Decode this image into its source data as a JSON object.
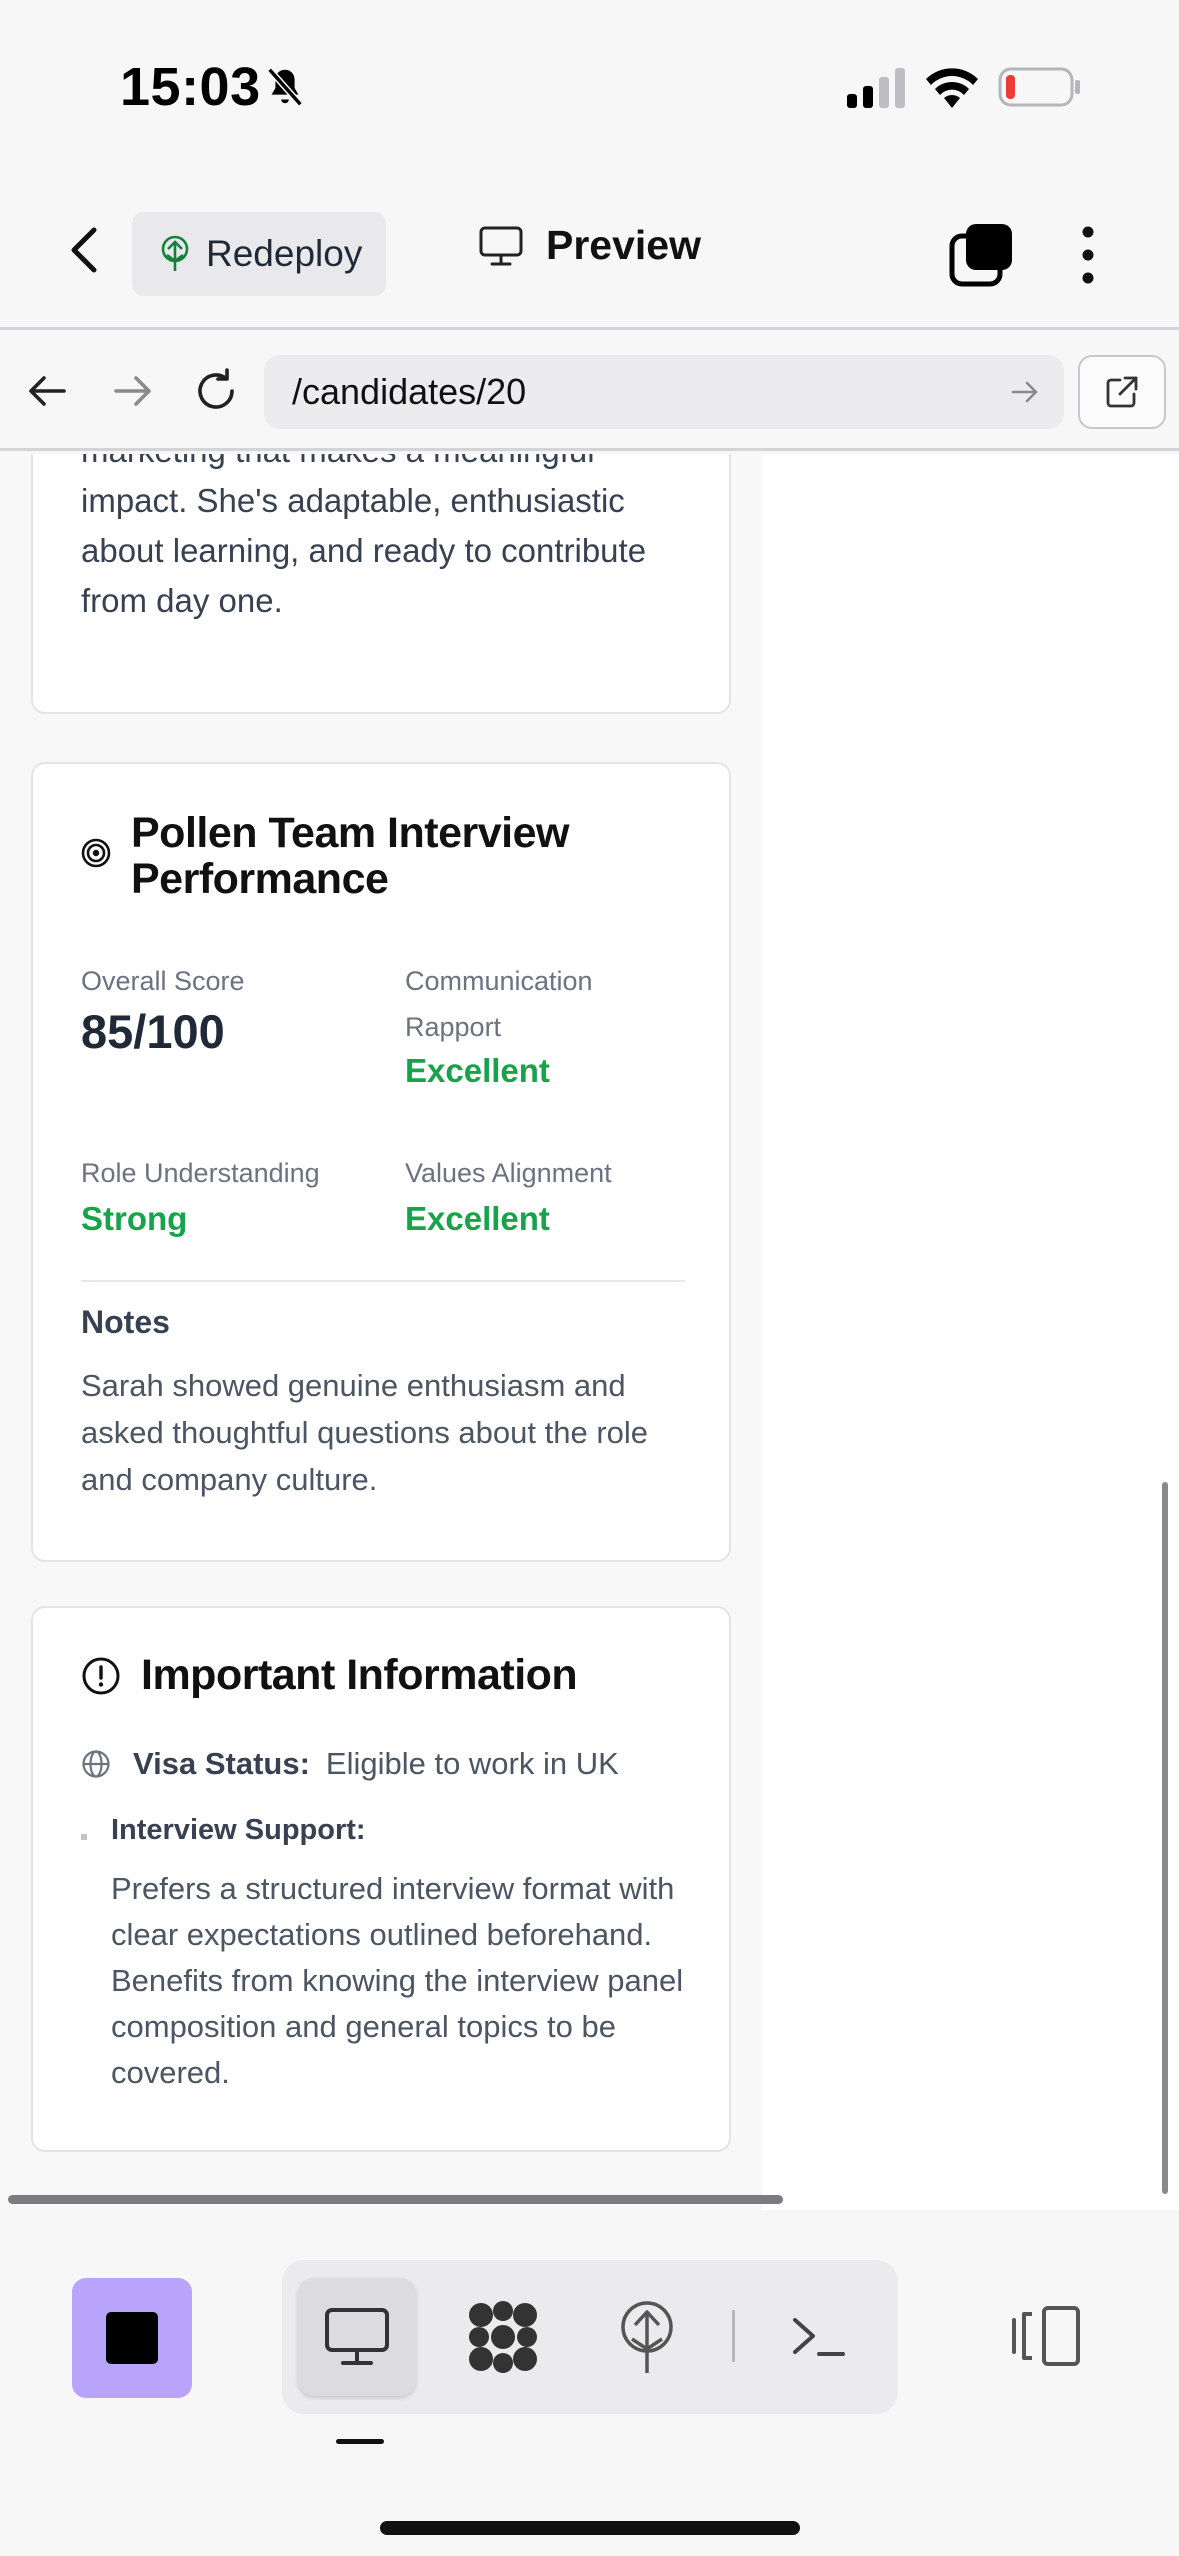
{
  "status": {
    "time": "15:03"
  },
  "header": {
    "redeploy_label": "Redeploy",
    "preview_label": "Preview"
  },
  "browser": {
    "url": "/candidates/20"
  },
  "summary_card": {
    "text": "marketing that makes a meaningful impact. She's adaptable, enthusiastic about learning, and ready to contribute from day one."
  },
  "interview_card": {
    "title": "Pollen Team Interview Performance",
    "overall_label": "Overall Score",
    "overall_value": "85/100",
    "communication_label": "Communication Rapport",
    "communication_value": "Excellent",
    "role_label": "Role Understanding",
    "role_value": "Strong",
    "values_label": "Values Alignment",
    "values_value": "Excellent",
    "notes_heading": "Notes",
    "notes_text": "Sarah showed genuine enthusiasm and asked thoughtful questions about the role and company culture."
  },
  "info_card": {
    "title": "Important Information",
    "visa_label": "Visa Status:",
    "visa_value": "Eligible to work in UK",
    "support_label": "Interview Support:",
    "support_text": "Prefers a structured interview format with clear expectations outlined beforehand. Benefits from knowing the interview panel composition and general topics to be covered."
  },
  "colors": {
    "accent_green": "#16a34a",
    "stop_button": "#b9a4fb"
  },
  "icons": {
    "status": [
      "bell-off-icon",
      "signal-icon",
      "wifi-icon",
      "battery-icon"
    ],
    "toolbar": [
      "monitor-icon",
      "grid-blob-icon",
      "tree-deploy-icon",
      "terminal-icon",
      "panel-toggle-icon"
    ]
  }
}
